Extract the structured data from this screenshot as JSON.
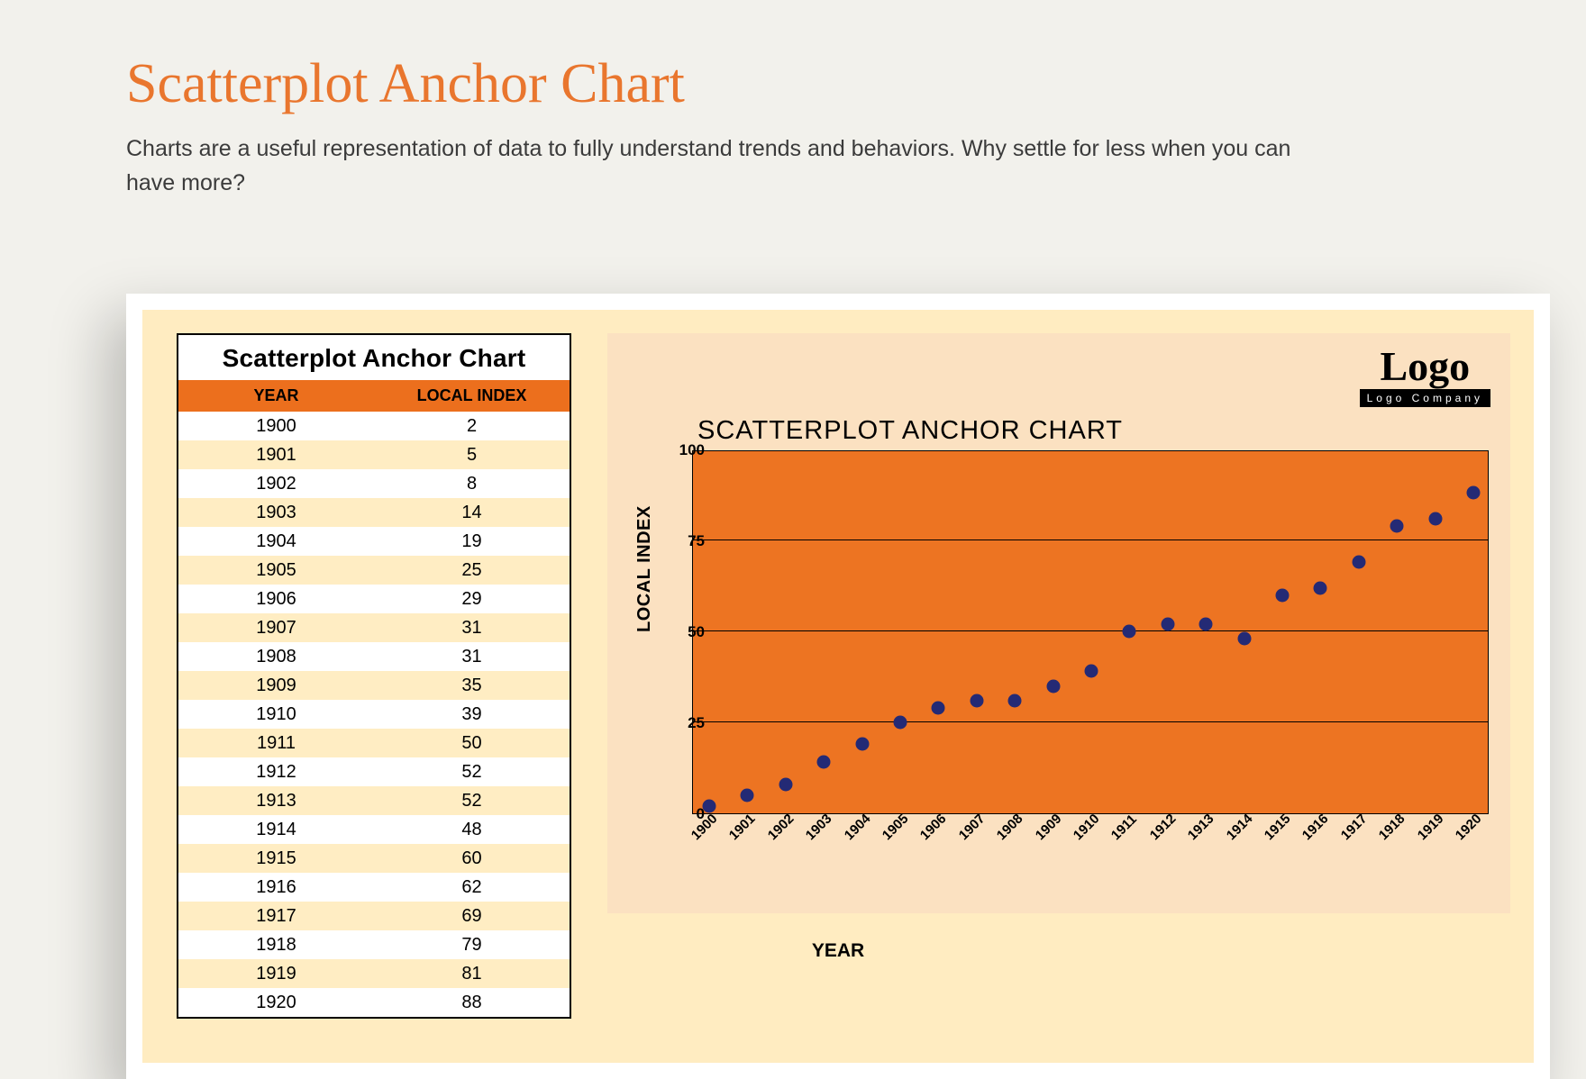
{
  "page": {
    "title": "Scatterplot Anchor Chart",
    "subtitle": "Charts are a useful representation of data to fully understand trends and behaviors. Why settle for less when you can have more?"
  },
  "table": {
    "title": "Scatterplot Anchor Chart",
    "col_year": "YEAR",
    "col_value": "LOCAL INDEX"
  },
  "logo": {
    "word": "Logo",
    "strip": "Logo Company"
  },
  "chart_label": {
    "title": "SCATTERPLOT ANCHOR CHART",
    "ylabel": "LOCAL INDEX",
    "xlabel": "YEAR"
  },
  "chart_data": {
    "type": "scatter",
    "title": "SCATTERPLOT ANCHOR CHART",
    "xlabel": "YEAR",
    "ylabel": "LOCAL INDEX",
    "ylim": [
      0,
      100
    ],
    "y_ticks": [
      0,
      25,
      50,
      75,
      100
    ],
    "x": [
      1900,
      1901,
      1902,
      1903,
      1904,
      1905,
      1906,
      1907,
      1908,
      1909,
      1910,
      1911,
      1912,
      1913,
      1914,
      1915,
      1916,
      1917,
      1918,
      1919,
      1920
    ],
    "values": [
      2,
      5,
      8,
      14,
      19,
      25,
      29,
      31,
      31,
      35,
      39,
      50,
      52,
      52,
      48,
      60,
      62,
      69,
      79,
      81,
      88
    ]
  }
}
